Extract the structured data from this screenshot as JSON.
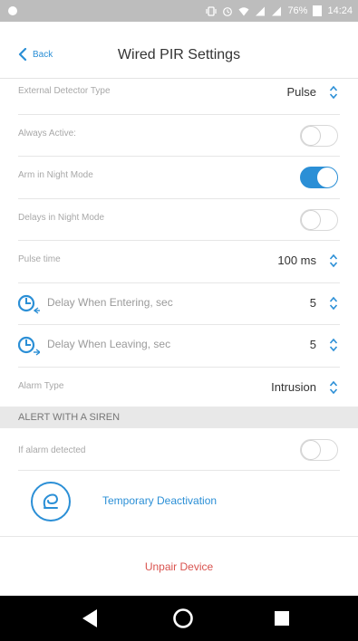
{
  "status_bar": {
    "battery": "76%",
    "time": "14:24"
  },
  "header": {
    "back_label": "Back",
    "title": "Wired PIR Settings"
  },
  "settings": {
    "external_detector_type": {
      "label": "External Detector Type",
      "value": "Pulse"
    },
    "always_active": {
      "label": "Always Active:",
      "on": false
    },
    "arm_night_mode": {
      "label": "Arm in Night Mode",
      "on": true
    },
    "delays_night_mode": {
      "label": "Delays in Night Mode",
      "on": false
    },
    "pulse_time": {
      "label": "Pulse time",
      "value": "100 ms"
    },
    "delay_entering": {
      "label": "Delay When Entering, sec",
      "value": "5"
    },
    "delay_leaving": {
      "label": "Delay When Leaving, sec",
      "value": "5"
    },
    "alarm_type": {
      "label": "Alarm Type",
      "value": "Intrusion"
    }
  },
  "siren_section": {
    "title": "ALERT WITH A SIREN",
    "if_alarm_detected": {
      "label": "If alarm detected",
      "on": false
    }
  },
  "temporary_deactivation": {
    "label": "Temporary Deactivation"
  },
  "unpair": {
    "label": "Unpair Device"
  },
  "colors": {
    "accent": "#2b8fd6",
    "danger": "#d9534f"
  }
}
